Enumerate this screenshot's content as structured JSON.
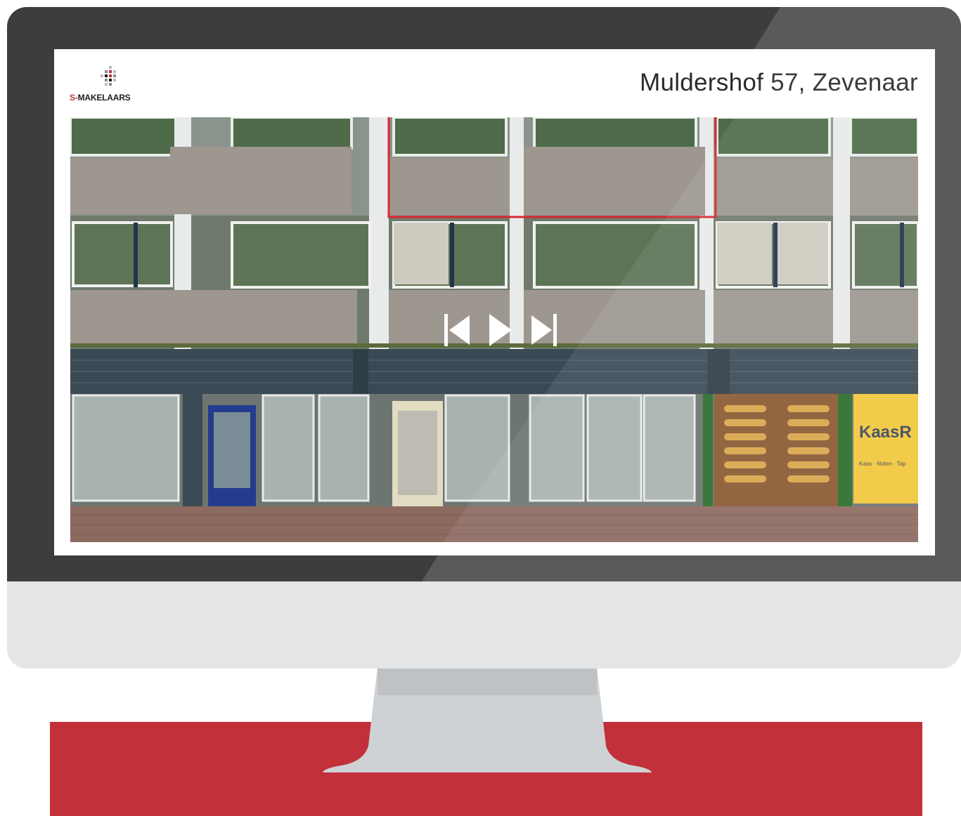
{
  "page": {
    "brand": {
      "prefix": "S-",
      "name": "MAKELAARS"
    },
    "address": "Muldershof 57, Zevenaar"
  },
  "photo": {
    "subject": "building-facade",
    "signs": {
      "shop": "KaasR",
      "shop_sub": "Kaas · Noten · Tap"
    }
  },
  "player": {
    "controls": [
      {
        "name": "previous",
        "icon": "skip-previous-icon"
      },
      {
        "name": "play",
        "icon": "play-icon"
      },
      {
        "name": "next",
        "icon": "skip-next-icon"
      }
    ]
  },
  "colors": {
    "brand_red": "#c2303a",
    "bezel": "#3d3d3d",
    "chin": "#e4e5e7",
    "stand": "#cfd2d4"
  }
}
